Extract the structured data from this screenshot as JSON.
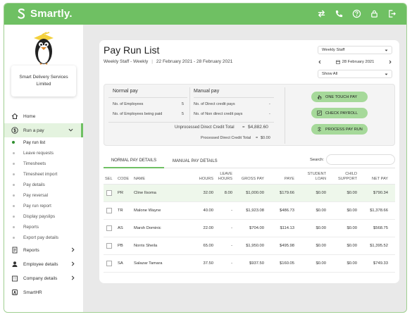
{
  "app": {
    "brand": "Smartly."
  },
  "topbar": {
    "icons": [
      "swap-icon",
      "phone-icon",
      "help-icon",
      "lock-icon",
      "logout-icon"
    ]
  },
  "sidebar": {
    "company": "Smart Delivery Services Limited",
    "items": [
      {
        "label": "Home",
        "icon": "home-icon"
      },
      {
        "label": "Run a pay",
        "icon": "dollar-icon"
      },
      {
        "label": "Reports",
        "icon": "report-icon"
      },
      {
        "label": "Employee details",
        "icon": "user-icon"
      },
      {
        "label": "Company details",
        "icon": "building-icon"
      },
      {
        "label": "SmartHR",
        "icon": "hr-icon"
      }
    ],
    "subitems": [
      "Pay run list",
      "Leave requests",
      "Timesheets",
      "Timesheet import",
      "Pay details",
      "Pay reversal",
      "Pay run report",
      "Display payslips",
      "Reports",
      "Export pay details"
    ]
  },
  "page": {
    "title": "Pay Run List",
    "staff_label": "Weekly Staff - Weekly",
    "date_range": "22 February 2021 - 28 February 2021"
  },
  "filters": {
    "staff_select": "Weekly Staff",
    "date": "28 February 2021",
    "show_select": "Show All"
  },
  "summary": {
    "normal_pay": {
      "heading": "Normal pay",
      "lines": [
        {
          "label": "No. of Employees",
          "value": "5"
        },
        {
          "label": "No. of Employees being paid",
          "value": "5"
        }
      ]
    },
    "manual_pay": {
      "heading": "Manual pay",
      "lines": [
        {
          "label": "No. of Direct credit pays",
          "value": "-"
        },
        {
          "label": "No. of Non direct credit pays",
          "value": "-"
        }
      ]
    },
    "unprocessed": {
      "label": "Unprocessed Direct Credit Total",
      "eq": "=",
      "value": "$4,882.60"
    },
    "processed": {
      "label": "Processed Direct Credit Total",
      "eq": "=",
      "value": "$0.00"
    },
    "buttons": [
      "ONE TOUCH PAY",
      "CHECK PAYROLL",
      "PROCESS PAY RUN"
    ]
  },
  "tabs": [
    "NORMAL PAY DETAILS",
    "MANUAL PAY DETAILS"
  ],
  "search": {
    "label": "Search:"
  },
  "table": {
    "headers": {
      "sel": "SEL",
      "code": "CODE",
      "name": "NAME",
      "hours": "HOURS",
      "leave1": "LEAVE",
      "leave2": "HOURS",
      "gross": "GROSS PAY",
      "paye": "PAYE",
      "student1": "STUDENT",
      "student2": "LOAN",
      "child1": "CHILD",
      "child2": "SUPPORT",
      "net": "NET PAY"
    },
    "rows": [
      {
        "code": "PR",
        "name": "Cline Ilsoma",
        "hours": "32.00",
        "leave": "8.00",
        "gross": "$1,000.00",
        "paye": "$179.66",
        "student": "$0.00",
        "child": "$0.00",
        "net": "$790.34"
      },
      {
        "code": "TR",
        "name": "Malone Wayne",
        "hours": "40.00",
        "leave": "-",
        "gross": "$1,923.08",
        "paye": "$486.73",
        "student": "$0.00",
        "child": "$0.00",
        "net": "$1,378.66"
      },
      {
        "code": "AS",
        "name": "Marsh Dominic",
        "hours": "22.00",
        "leave": "-",
        "gross": "$704.00",
        "paye": "$114.13",
        "student": "$0.00",
        "child": "$0.00",
        "net": "$568.75"
      },
      {
        "code": "PB",
        "name": "Norris Sheila",
        "hours": "65.00",
        "leave": "-",
        "gross": "$1,950.00",
        "paye": "$495.98",
        "student": "$0.00",
        "child": "$0.00",
        "net": "$1,395.52"
      },
      {
        "code": "SA",
        "name": "Salazar Tamara",
        "hours": "37.50",
        "leave": "-",
        "gross": "$937.50",
        "paye": "$160.05",
        "student": "$0.00",
        "child": "$0.00",
        "net": "$749.33"
      }
    ]
  },
  "colors": {
    "brand_green": "#6fc063",
    "button_green": "#a6d99a",
    "highlight_row": "#eef7eb"
  }
}
